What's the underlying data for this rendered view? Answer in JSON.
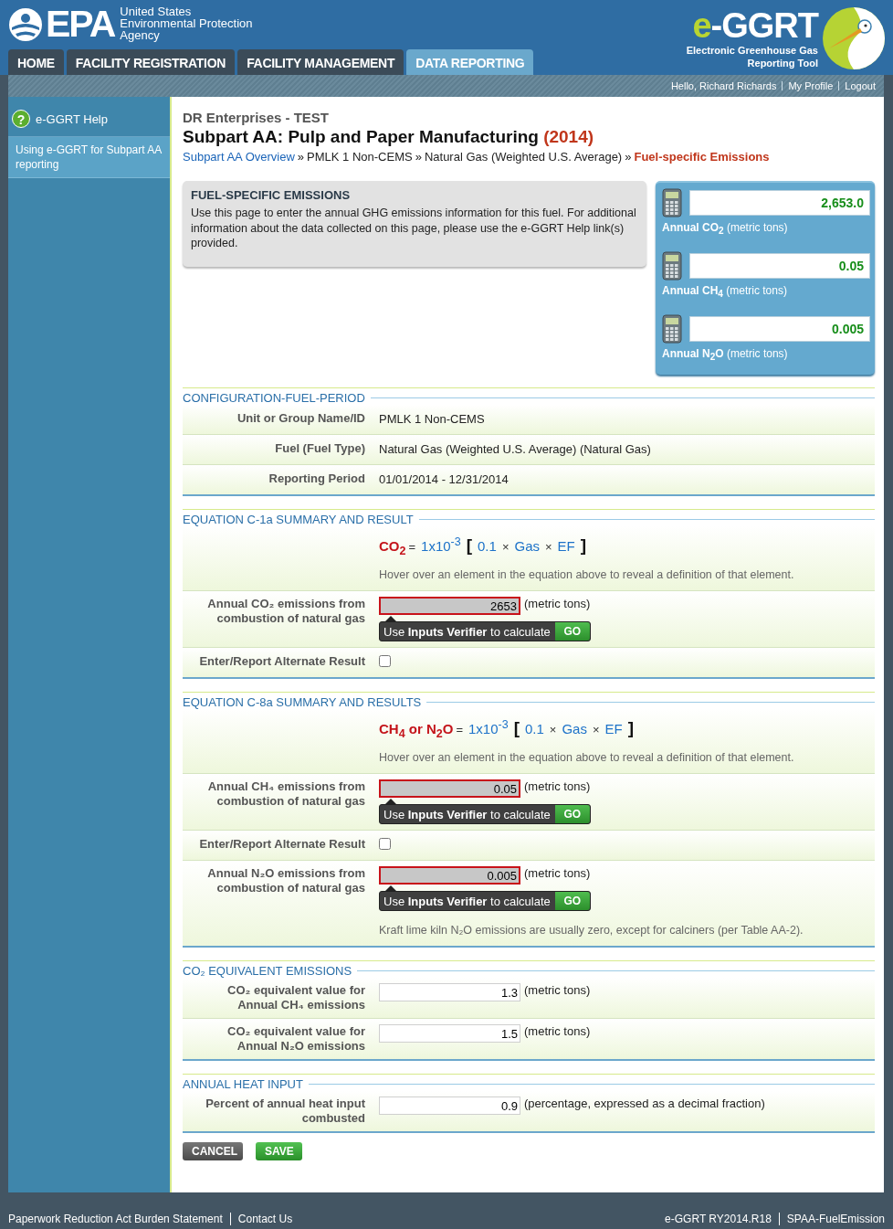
{
  "header": {
    "logo_word": "EPA",
    "agency": [
      "United States",
      "Environmental Protection",
      "Agency"
    ],
    "brand_mark": "e",
    "brand_name": "-GGRT",
    "brand_subtitle": [
      "Electronic Greenhouse Gas",
      "Reporting Tool"
    ]
  },
  "tabs": [
    {
      "label": "HOME",
      "selected": false
    },
    {
      "label": "FACILITY REGISTRATION",
      "selected": false
    },
    {
      "label": "FACILITY MANAGEMENT",
      "selected": false
    },
    {
      "label": "DATA REPORTING",
      "selected": true
    }
  ],
  "user_bar": {
    "greeting": "Hello, Richard Richards",
    "links": [
      "My Profile",
      "Logout"
    ]
  },
  "sidebar": {
    "help": {
      "glyph": "?",
      "label": "e-GGRT Help"
    },
    "items": [
      {
        "label": "Using e-GGRT for Subpart AA reporting",
        "selected": false
      }
    ]
  },
  "page": {
    "organization": "DR Enterprises - TEST",
    "title": "Subpart AA: Pulp and Paper Manufacturing",
    "year": "(2014)",
    "breadcrumbs": [
      {
        "kind": "link",
        "text": "Subpart AA Overview"
      },
      {
        "kind": "text",
        "text": "PMLK 1 Non-CEMS"
      },
      {
        "kind": "text",
        "text": "Natural Gas (Weighted U.S. Average)"
      },
      {
        "kind": "current",
        "text": "Fuel-specific Emissions"
      }
    ],
    "separator": "»"
  },
  "info_box": {
    "heading": "FUEL-SPECIFIC EMISSIONS",
    "text": "Use this page to enter the annual GHG emissions information for this fuel. For additional information about the data collected on this page, please use the e-GGRT Help link(s) provided."
  },
  "totals": [
    {
      "value": "2,653.0",
      "label": "**Annual CO$_{2}$** (metric tons)"
    },
    {
      "value": "0.05",
      "label": "**Annual CH$_{4}$** (metric tons)"
    },
    {
      "value": "0.005",
      "label": "**Annual N$_{2}$O** (metric tons)"
    }
  ],
  "sections": [
    {
      "title": "CONFIGURATION-FUEL-PERIOD",
      "rows": [
        {
          "kind": "static",
          "label": "Unit or Group Name/ID",
          "value": "PMLK 1 Non-CEMS"
        },
        {
          "kind": "static",
          "label": "Fuel (Fuel Type)",
          "value": "Natural Gas (Weighted U.S. Average) (Natural Gas)"
        },
        {
          "kind": "static",
          "label": "Reporting Period",
          "value": "01/01/2014 - 12/31/2014"
        }
      ]
    },
    {
      "title": "EQUATION C-1a SUMMARY AND RESULT",
      "rows": [
        {
          "kind": "equation",
          "lhs": "CO$_{2}$",
          "terms": [
            {
              "kind": "op",
              "text": "="
            },
            {
              "kind": "term",
              "text": "1x10$^{-3}$"
            },
            {
              "kind": "bracket",
              "text": "["
            },
            {
              "kind": "term",
              "text": "0.1"
            },
            {
              "kind": "op",
              "text": "×"
            },
            {
              "kind": "term",
              "text": "Gas"
            },
            {
              "kind": "op",
              "text": "×"
            },
            {
              "kind": "term",
              "text": "EF"
            },
            {
              "kind": "bracket",
              "text": "]"
            }
          ],
          "hint": "Hover over an element in the equation above to reveal a definition of that element."
        },
        {
          "kind": "computed",
          "label": "Annual CO₂ emissions from combustion of natural gas",
          "value": "2653",
          "unit": "(metric tons)",
          "verifier": "Use **Inputs Verifier** to calculate",
          "go": "GO"
        },
        {
          "kind": "checkbox",
          "label": "Enter/Report Alternate Result",
          "checked": false
        }
      ]
    },
    {
      "title": "EQUATION C-8a SUMMARY AND RESULTS",
      "rows": [
        {
          "kind": "equation",
          "lhs": "CH$_{4}$ or N$_{2}$O",
          "terms": [
            {
              "kind": "op",
              "text": "="
            },
            {
              "kind": "term",
              "text": "1x10$^{-3}$"
            },
            {
              "kind": "bracket",
              "text": "["
            },
            {
              "kind": "term",
              "text": "0.1"
            },
            {
              "kind": "op",
              "text": "×"
            },
            {
              "kind": "term",
              "text": "Gas"
            },
            {
              "kind": "op",
              "text": "×"
            },
            {
              "kind": "term",
              "text": "EF"
            },
            {
              "kind": "bracket",
              "text": "]"
            }
          ],
          "hint": "Hover over an element in the equation above to reveal a definition of that element."
        },
        {
          "kind": "computed",
          "label": "Annual CH₄ emissions from combustion of natural gas",
          "value": "0.05",
          "unit": "(metric tons)",
          "verifier": "Use **Inputs Verifier** to calculate",
          "go": "GO"
        },
        {
          "kind": "checkbox",
          "label": "Enter/Report Alternate Result",
          "checked": false
        },
        {
          "kind": "computed",
          "label": "Annual N₂O emissions from combustion of natural gas",
          "value": "0.005",
          "unit": "(metric tons)",
          "verifier": "Use **Inputs Verifier** to calculate",
          "go": "GO",
          "note": "Kraft lime kiln N₂O emissions are usually zero, except for calciners (per Table AA-2)."
        }
      ]
    },
    {
      "title": "CO₂ EQUIVALENT EMISSIONS",
      "rows": [
        {
          "kind": "input",
          "label": "CO₂ equivalent value for Annual CH₄ emissions",
          "value": "1.3",
          "unit": "(metric tons)"
        },
        {
          "kind": "input",
          "label": "CO₂ equivalent value for Annual N₂O emissions",
          "value": "1.5",
          "unit": "(metric tons)"
        }
      ]
    },
    {
      "title": "ANNUAL HEAT INPUT",
      "rows": [
        {
          "kind": "input",
          "label": "Percent of annual heat input combusted",
          "value": "0.9",
          "unit": "(percentage, expressed as a decimal fraction)"
        }
      ]
    }
  ],
  "buttons": [
    {
      "kind": "cancel",
      "label": "CANCEL"
    },
    {
      "kind": "save",
      "label": "SAVE"
    }
  ],
  "footer": {
    "links": [
      "Paperwork Reduction Act Burden Statement",
      "Contact Us"
    ],
    "info": [
      "e-GGRT RY2014.R18",
      "SPAA-FuelEmission"
    ]
  }
}
